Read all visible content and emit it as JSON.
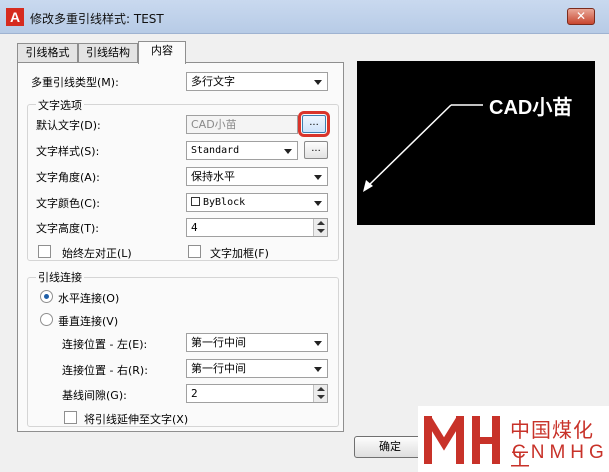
{
  "window": {
    "title": "修改多重引线样式: TEST",
    "app_icon_glyph": "A",
    "close_glyph": "✕"
  },
  "tabs": [
    {
      "label": "引线格式",
      "active": false
    },
    {
      "label": "引线结构",
      "active": false
    },
    {
      "label": "内容",
      "active": true
    }
  ],
  "content": {
    "mleader_type_label": "多重引线类型(M):",
    "mleader_type_value": "多行文字",
    "text_options": {
      "title": "文字选项",
      "default_text_label": "默认文字(D):",
      "default_text_value": "CAD小苗",
      "default_text_button": "...",
      "text_style_label": "文字样式(S):",
      "text_style_value": "Standard",
      "text_style_button": "...",
      "text_angle_label": "文字角度(A):",
      "text_angle_value": "保持水平",
      "text_color_label": "文字颜色(C):",
      "text_color_value": "ByBlock",
      "text_height_label": "文字高度(T):",
      "text_height_value": "4",
      "always_left_label": "始终左对正(L)",
      "always_left_checked": false,
      "text_frame_label": "文字加框(F)",
      "text_frame_checked": false
    },
    "leader_connection": {
      "title": "引线连接",
      "horizontal_label": "水平连接(O)",
      "horizontal_checked": true,
      "vertical_label": "垂直连接(V)",
      "vertical_checked": false,
      "attach_left_label": "连接位置 - 左(E):",
      "attach_left_value": "第一行中间",
      "attach_right_label": "连接位置 - 右(R):",
      "attach_right_value": "第一行中间",
      "landing_gap_label": "基线间隙(G):",
      "landing_gap_value": "2",
      "extend_leader_label": "将引线延伸至文字(X)",
      "extend_leader_checked": false
    }
  },
  "preview": {
    "text": "CAD小苗"
  },
  "buttons": {
    "ok_label": "确定"
  },
  "watermark": {
    "chinese": "中国煤化工",
    "english": "CNMHG"
  },
  "colors": {
    "highlight": "#d9342b",
    "watermark": "#c83229",
    "radio_dot": "#1f5fa8"
  }
}
